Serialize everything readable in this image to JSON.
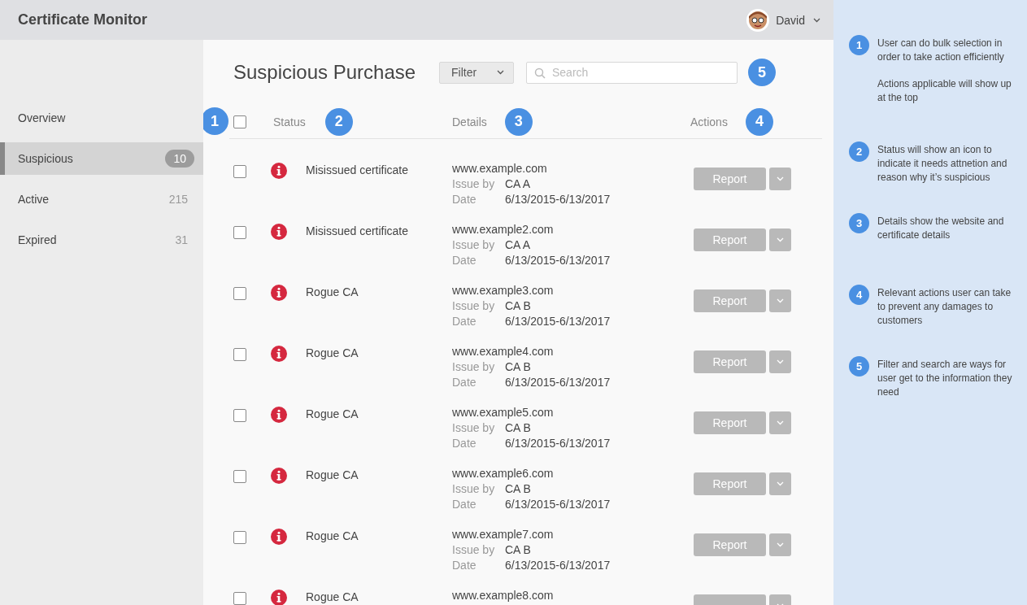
{
  "app": {
    "title": "Certificate Monitor"
  },
  "user": {
    "name": "David"
  },
  "sidebar": {
    "items": [
      {
        "label": "Overview",
        "selected": false
      },
      {
        "label": "Suspicious",
        "count": "10",
        "selected": true
      },
      {
        "label": "Active",
        "count": "215",
        "selected": false
      },
      {
        "label": "Expired",
        "count": "31",
        "selected": false
      }
    ]
  },
  "page": {
    "title": "Suspicious Purchase",
    "filter": "Filter",
    "search": {
      "placeholder": "Search"
    },
    "marker": "5"
  },
  "table": {
    "select_all": {
      "checked": false
    },
    "marker": "1",
    "columns": [
      {
        "label": "Status",
        "marker": "2"
      },
      {
        "label": "Details",
        "marker": "3"
      },
      {
        "label": "Actions",
        "marker": "4"
      }
    ],
    "rows": [
      {
        "checked": false,
        "status": "Misissued certificate",
        "domain": "www.example.com",
        "issuer_label": "Issue by",
        "issuer": "CA A",
        "date_label": "Date",
        "date": "6/13/2015-6/13/2017",
        "action": "Report"
      },
      {
        "checked": false,
        "status": "Misissued certificate",
        "domain": "www.example2.com",
        "issuer_label": "Issue by",
        "issuer": "CA A",
        "date_label": "Date",
        "date": "6/13/2015-6/13/2017",
        "action": "Report"
      },
      {
        "checked": false,
        "status": "Rogue CA",
        "domain": "www.example3.com",
        "issuer_label": "Issue by",
        "issuer": "CA B",
        "date_label": "Date",
        "date": "6/13/2015-6/13/2017",
        "action": "Report"
      },
      {
        "checked": false,
        "status": "Rogue CA",
        "domain": "www.example4.com",
        "issuer_label": "Issue by",
        "issuer": "CA B",
        "date_label": "Date",
        "date": "6/13/2015-6/13/2017",
        "action": "Report"
      },
      {
        "checked": false,
        "status": "Rogue CA",
        "domain": "www.example5.com",
        "issuer_label": "Issue by",
        "issuer": "CA B",
        "date_label": "Date",
        "date": "6/13/2015-6/13/2017",
        "action": "Report"
      },
      {
        "checked": false,
        "status": "Rogue CA",
        "domain": "www.example6.com",
        "issuer_label": "Issue by",
        "issuer": "CA B",
        "date_label": "Date",
        "date": "6/13/2015-6/13/2017",
        "action": "Report"
      },
      {
        "checked": false,
        "status": "Rogue CA",
        "domain": "www.example7.com",
        "issuer_label": "Issue by",
        "issuer": "CA B",
        "date_label": "Date",
        "date": "6/13/2015-6/13/2017",
        "action": "Report"
      },
      {
        "checked": false,
        "status": "Rogue CA",
        "domain": "www.example8.com"
      }
    ]
  },
  "notes": [
    {
      "marker": "1",
      "paragraphs": [
        "User can do bulk selection in order to take action efficiently",
        "Actions applicable will show up at the top"
      ]
    },
    {
      "marker": "2",
      "paragraphs": [
        "Status will show an icon to indicate it needs attnetion and reason why it’s suspicious"
      ]
    },
    {
      "marker": "3",
      "paragraphs": [
        "Details show the website and certificate details"
      ]
    },
    {
      "marker": "4",
      "paragraphs": [
        "Relevant actions user can take to prevent any damages to customers"
      ]
    },
    {
      "marker": "5",
      "paragraphs": [
        "Filter and search are ways for user get to the information they need"
      ]
    }
  ]
}
